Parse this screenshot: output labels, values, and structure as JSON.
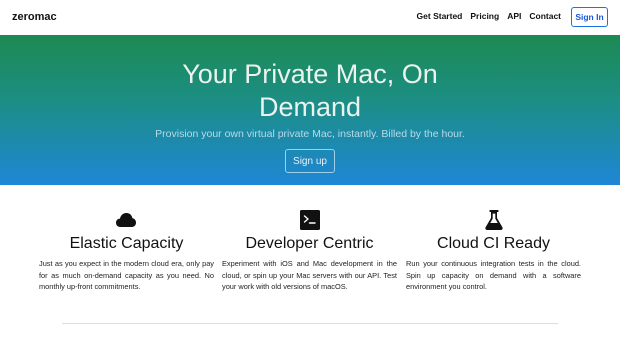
{
  "navbar": {
    "brand": "zeromac",
    "links": [
      "Get Started",
      "Pricing",
      "API",
      "Contact"
    ],
    "signin_label": "Sign In"
  },
  "hero": {
    "title_line1": "Your Private Mac, On",
    "title_line2": "Demand",
    "subtitle": "Provision your own virtual private Mac, instantly. Billed by the hour.",
    "cta_label": "Sign up"
  },
  "features": [
    {
      "icon": "cloud-icon",
      "title": "Elastic Capacity",
      "text": "Just as you expect in the modern cloud era, only pay for as much on-demand capacity as you need. No monthly up-front commitments."
    },
    {
      "icon": "terminal-icon",
      "title": "Developer Centric",
      "text": "Experiment with iOS and Mac development in the cloud, or spin up your Mac servers with our API. Test your work with old versions of macOS."
    },
    {
      "icon": "flask-icon",
      "title": "Cloud CI Ready",
      "text": "Run your continuous integration tests in the cloud. Spin up capacity on demand with a software environment you control."
    }
  ],
  "colors": {
    "accent": "#1a73e8",
    "hero_top": "#1d8a52",
    "hero_bottom": "#1e86d6"
  }
}
